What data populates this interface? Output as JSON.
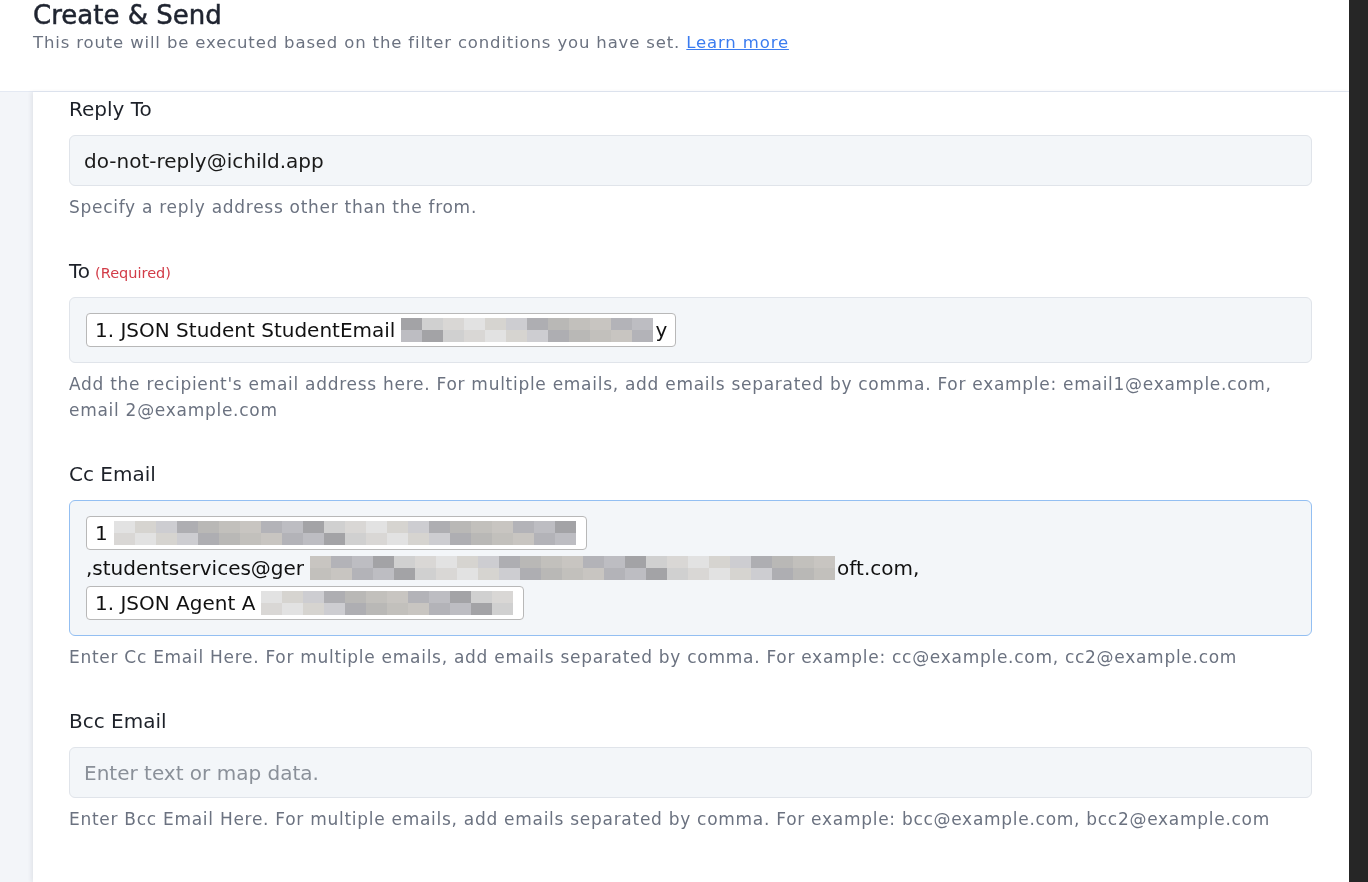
{
  "header": {
    "title": "Create & Send",
    "description": "This route will be executed based on the filter conditions you have set.",
    "link": "Learn more"
  },
  "fields": [
    {
      "kind": "text",
      "label": "Reply To",
      "focused": false,
      "value": "do-not-reply@ichild.app",
      "help": "Specify a reply address other than the from."
    },
    {
      "kind": "tokens",
      "label": "To",
      "required": "(Required)",
      "focused": false,
      "lines": [
        [
          {
            "kind": "chip",
            "text": "1. JSON Student StudentEmail",
            "redacted": true,
            "tail": "y"
          }
        ]
      ],
      "help": "Add the recipient's email address here. For multiple emails, add emails separated by comma. For example: email1@example.com, email 2@example.com"
    },
    {
      "kind": "tokens",
      "label": "Cc Email",
      "focused": true,
      "lines": [
        [
          {
            "kind": "chip",
            "text": "1",
            "redacted": true
          }
        ],
        [
          {
            "kind": "text",
            "text": ",studentservices@ger",
            "redacted": true,
            "tail": "oft.com,"
          }
        ],
        [
          {
            "kind": "chip",
            "text": "1. JSON Agent A",
            "redacted": true
          }
        ]
      ],
      "help": "Enter Cc Email Here. For multiple emails, add emails separated by comma. For example: cc@example.com, cc2@example.com"
    },
    {
      "kind": "text",
      "label": "Bcc Email",
      "focused": false,
      "placeholder": "Enter text or map data.",
      "help": "Enter Bcc Email Here. For multiple emails, add emails separated by comma. For example: bcc@example.com, bcc2@example.com"
    }
  ]
}
